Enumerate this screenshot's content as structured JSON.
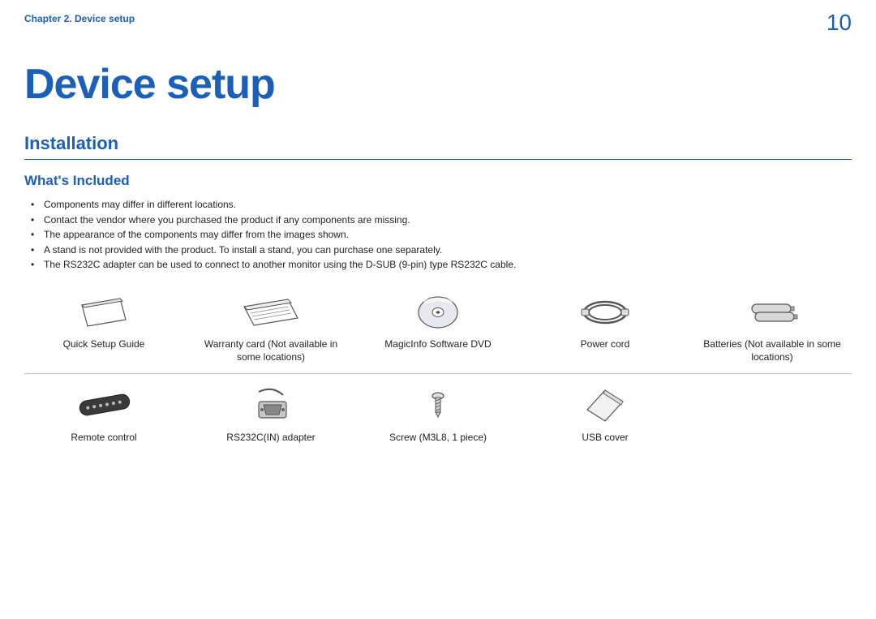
{
  "header": {
    "chapter": "Chapter 2. Device setup",
    "page_number": "10"
  },
  "title": "Device setup",
  "section": "Installation",
  "subsection": "What's Included",
  "bullets": [
    "Components may differ in different locations.",
    "Contact the vendor where you purchased the product if any components are missing.",
    "The appearance of the components may differ from the images shown.",
    "A stand is not provided with the product. To install a stand, you can purchase one separately.",
    "The RS232C adapter can be used to connect to another monitor using the D-SUB (9-pin) type RS232C cable."
  ],
  "items_row1": [
    {
      "name": "quick-setup-guide",
      "label": "Quick Setup Guide"
    },
    {
      "name": "warranty-card",
      "label": "Warranty card (Not available in some locations)"
    },
    {
      "name": "magicinfo-dvd",
      "label": "MagicInfo Software DVD"
    },
    {
      "name": "power-cord",
      "label": "Power cord"
    },
    {
      "name": "batteries",
      "label": "Batteries (Not available in some locations)"
    }
  ],
  "items_row2": [
    {
      "name": "remote-control",
      "label": "Remote control"
    },
    {
      "name": "rs232c-adapter",
      "label": "RS232C(IN) adapter"
    },
    {
      "name": "screw",
      "label": "Screw (M3L8, 1 piece)"
    },
    {
      "name": "usb-cover",
      "label": "USB cover"
    }
  ]
}
